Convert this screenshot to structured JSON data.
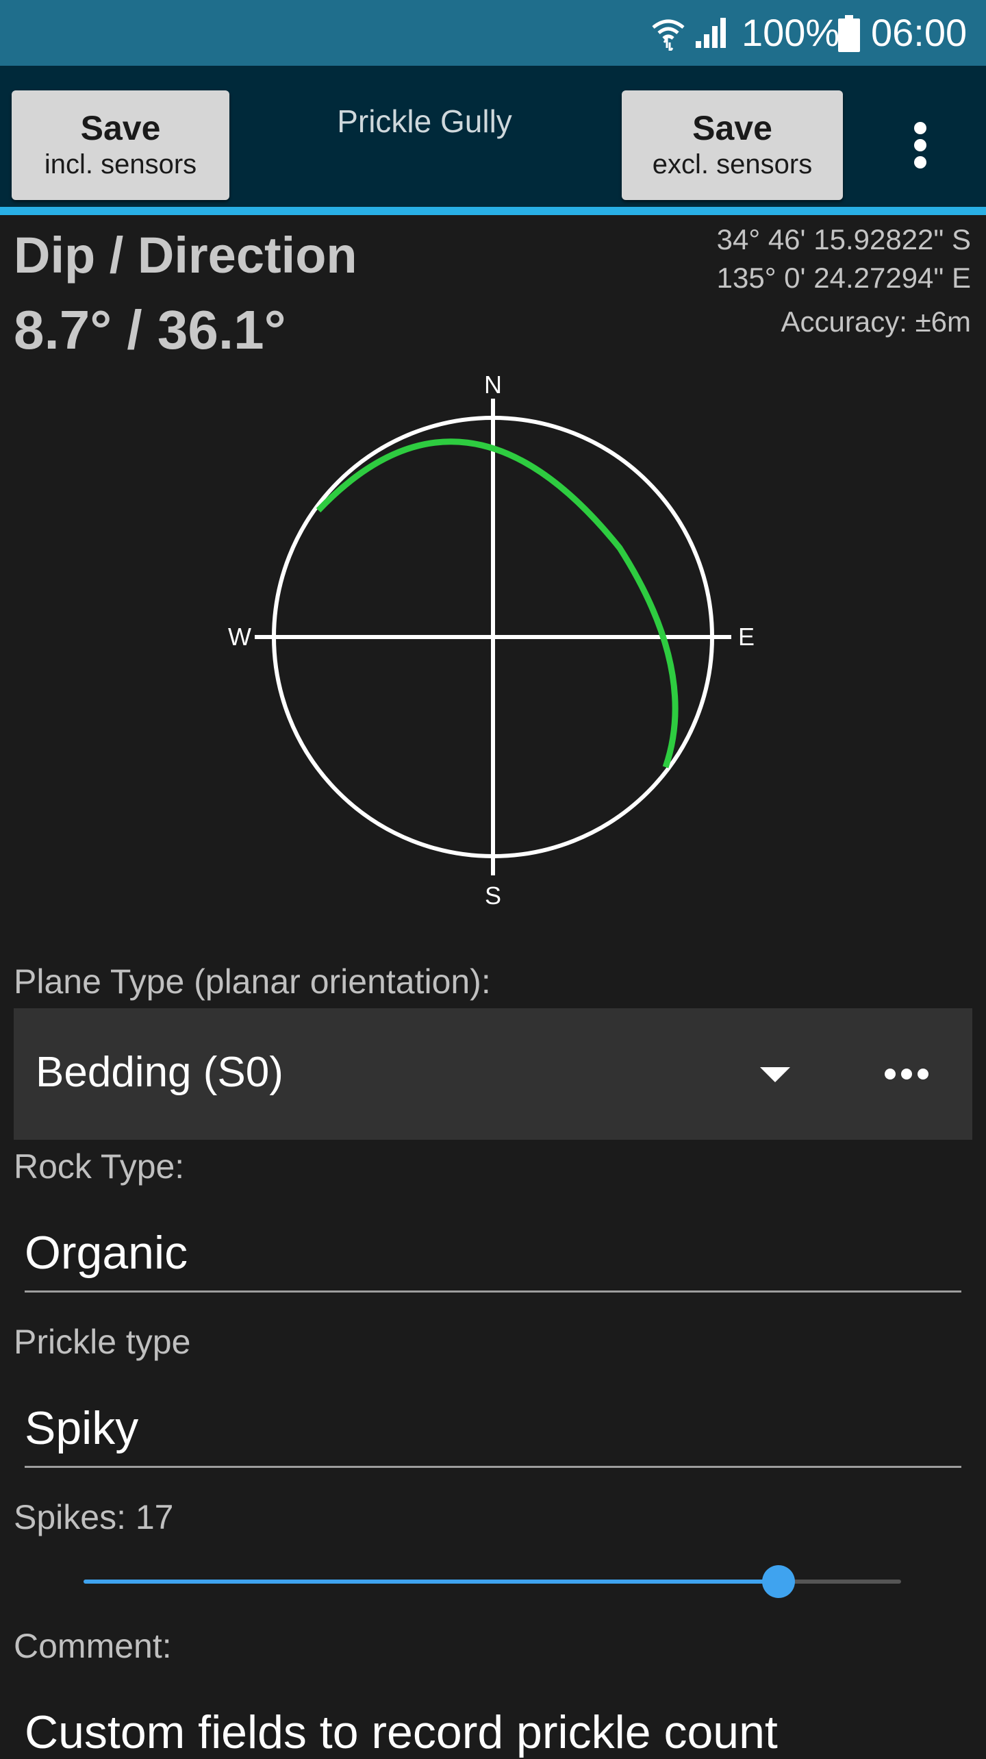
{
  "status_bar": {
    "battery_text": "100%",
    "time": "06:00",
    "icons": [
      "wifi-icon",
      "signal-icon",
      "battery-icon"
    ]
  },
  "action_bar": {
    "save_incl": {
      "line1": "Save",
      "line2": "incl. sensors"
    },
    "title": "Prickle Gully",
    "save_excl": {
      "line1": "Save",
      "line2": "excl. sensors"
    },
    "overflow_icon": "more-vert-icon"
  },
  "orientation": {
    "label": "Dip / Direction",
    "value": "8.7° / 36.1°",
    "dip_deg": 8.7,
    "direction_deg": 36.1
  },
  "location": {
    "latitude": "34° 46' 15.92822\" S",
    "longitude": "135° 0' 24.27294\" E",
    "accuracy": "Accuracy: ±6m"
  },
  "compass": {
    "north": "N",
    "south": "S",
    "east": "E",
    "west": "W",
    "colors": {
      "outline": "#ffffff",
      "great_circle": "#2ecc40"
    }
  },
  "form": {
    "plane_type_label": "Plane Type (planar orientation):",
    "plane_type_value": "Bedding (S0)",
    "rock_type_label": "Rock Type:",
    "rock_type_value": "Organic",
    "prickle_type_label": "Prickle type",
    "prickle_type_value": "Spiky",
    "spikes_label": "Spikes: 17",
    "spikes_slider_fraction": 0.85,
    "comment_label": "Comment:",
    "comment_value": "Custom fields to record prickle count"
  },
  "colors": {
    "status_bar": "#1f6e8c",
    "action_bar": "#00293a",
    "accent": "#29b0e6",
    "slider": "#3fa3ef",
    "background": "#1b1b1b"
  }
}
